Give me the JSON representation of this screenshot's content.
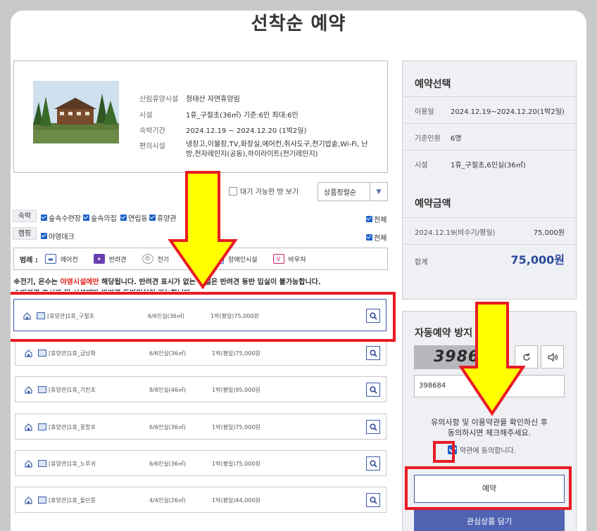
{
  "page_title": "선착순 예약",
  "facility_info": {
    "rows": [
      {
        "label": "산림휴양시설",
        "value": "청태산 자연휴양림"
      },
      {
        "label": "시설",
        "value": "1휴_구절초(36㎡) 기준:6인 최대:6인"
      },
      {
        "label": "숙박기간",
        "value": "2024.12.19 ~ 2024.12.20 (1박2일)"
      },
      {
        "label": "편의시설",
        "value": "냉장고,이불장,TV,화장실,에어컨,취사도구,전기밥솥,Wi-Fi, 난방,전자레인지(공동),하이라이트(전기레인지)"
      }
    ]
  },
  "wait_checkbox_label": "대기 가능한 방 보기",
  "sort_select": {
    "value": "상품정렬순"
  },
  "filters": {
    "stay_tag": "숙박",
    "stay_items": [
      "숲속수련장",
      "숲속의집",
      "연립동",
      "휴양관"
    ],
    "stay_all": "전체",
    "camp_tag": "캠핑",
    "camp_items": [
      "야영데크"
    ],
    "camp_all": "전체"
  },
  "legend": {
    "label": "범례 :",
    "items": [
      "에어컨",
      "반려견",
      "전기",
      "장애인시설",
      "바우처"
    ]
  },
  "notice": {
    "prefix": "※전기, 온수는 ",
    "highlight": "야영시설에만",
    "suffix": " 해당됩니다. 반려견 표시가 없는 시설은 반려견 동반 입실이 불가능합니다.",
    "line2": "※반려견 표시가 된 시설에만 반려견 동반입실이 가능합니다."
  },
  "rooms": [
    {
      "name": "[휴양관]1휴_구절초",
      "capacity": "6/6인실(36㎡)",
      "price": "1박(평일)75,000원",
      "selected": true
    },
    {
      "name": "[휴양관]1휴_금낭화",
      "capacity": "6/6인실(36㎡)",
      "price": "1박(평일)75,000원"
    },
    {
      "name": "[휴양관]1휴_기린초",
      "capacity": "8/8인실(46㎡)",
      "price": "1박(평일)95,000원"
    },
    {
      "name": "[휴양관]1휴_꽃창포",
      "capacity": "6/6인실(36㎡)",
      "price": "1박(평일)75,000원"
    },
    {
      "name": "[휴양관]1휴_노루귀",
      "capacity": "6/6인실(36㎡)",
      "price": "1박(평일)75,000원"
    },
    {
      "name": "[휴양관]1휴_돌단풍",
      "capacity": "4/4인실(26㎡)",
      "price": "1박(평일)44,000원"
    }
  ],
  "reservation": {
    "title": "예약선택",
    "rows": [
      {
        "label": "이용일",
        "value": "2024.12.19~2024.12.20(1박2일)"
      },
      {
        "label": "기준인원",
        "value": "6명"
      },
      {
        "label": "시설",
        "value": "1휴_구절초,6인실(36㎡)"
      }
    ],
    "amount_title": "예약금액",
    "amount_row": {
      "label": "2024.12.19(비수기/평일)",
      "value": "75,000원"
    },
    "total": {
      "label": "합계",
      "value": "75,000원"
    }
  },
  "auto_prevent": {
    "title": "자동예약 방지",
    "captcha_text": "398684",
    "input_value": "398684",
    "agree_text_1": "유의사항 및 이용약관을 확인하신 후",
    "agree_text_2": "동의하시면 체크해주세요.",
    "agree_label": "약관에 동의합니다.",
    "reserve_label": "예약",
    "wish_label": "관심상품 담기"
  },
  "colors": {
    "accent": "#3d5aa8",
    "highlight_red": "#e81c24",
    "arrow_yellow": "#ffff00",
    "notice_red": "#e02020"
  }
}
